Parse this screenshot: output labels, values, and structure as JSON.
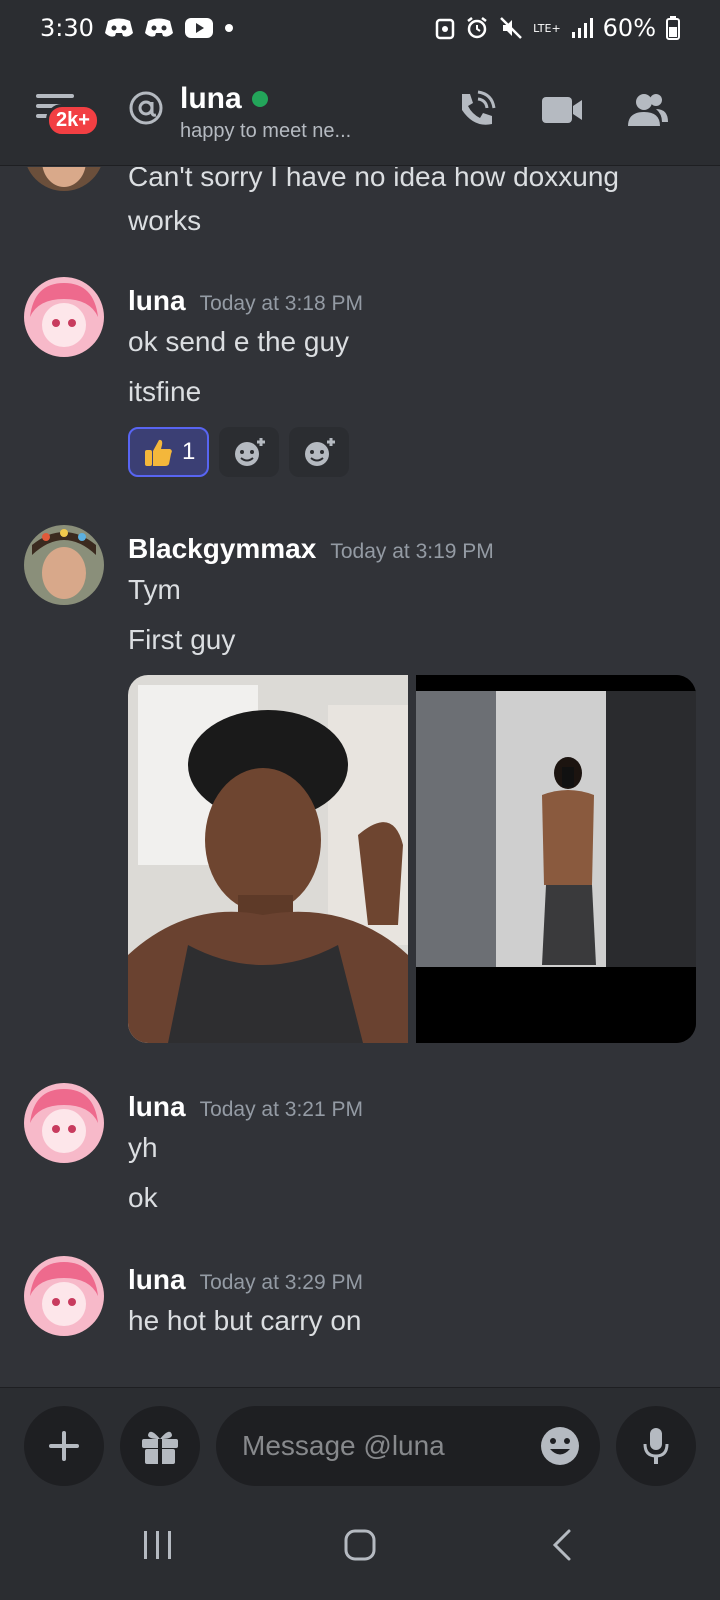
{
  "status_bar": {
    "time": "3:30",
    "network": "LTE+",
    "battery": "60%"
  },
  "header": {
    "unread_badge": "2k+",
    "dm_name": "luna",
    "dm_status": "happy to meet ne...",
    "online_color": "#23a55a"
  },
  "messages": {
    "partial": {
      "text_line1": "Can't sorry I have no idea how doxxung",
      "text_line2": "works"
    },
    "groups": [
      {
        "author": "luna",
        "timestamp": "Today at 3:18 PM",
        "lines": [
          "ok send e the guy",
          "itsfine"
        ],
        "reactions": [
          {
            "emoji": "thumbs-up",
            "count": "1",
            "active": true
          },
          {
            "emoji": "add-super-reaction"
          },
          {
            "emoji": "add-reaction"
          }
        ]
      },
      {
        "author": "Blackgymmax",
        "timestamp": "Today at 3:19 PM",
        "lines": [
          "Tym",
          "First guy"
        ],
        "attachments": [
          "selfie-photo",
          "mirror-photo"
        ]
      },
      {
        "author": "luna",
        "timestamp": "Today at 3:21 PM",
        "lines": [
          "yh",
          "ok"
        ]
      },
      {
        "author": "luna",
        "timestamp": "Today at 3:29 PM",
        "lines": [
          "he hot but carry on"
        ]
      }
    ]
  },
  "composer": {
    "placeholder": "Message @luna"
  },
  "colors": {
    "background": "#313338",
    "header": "#2b2d31",
    "accent": "#5865f2",
    "badge": "#f23f43"
  }
}
